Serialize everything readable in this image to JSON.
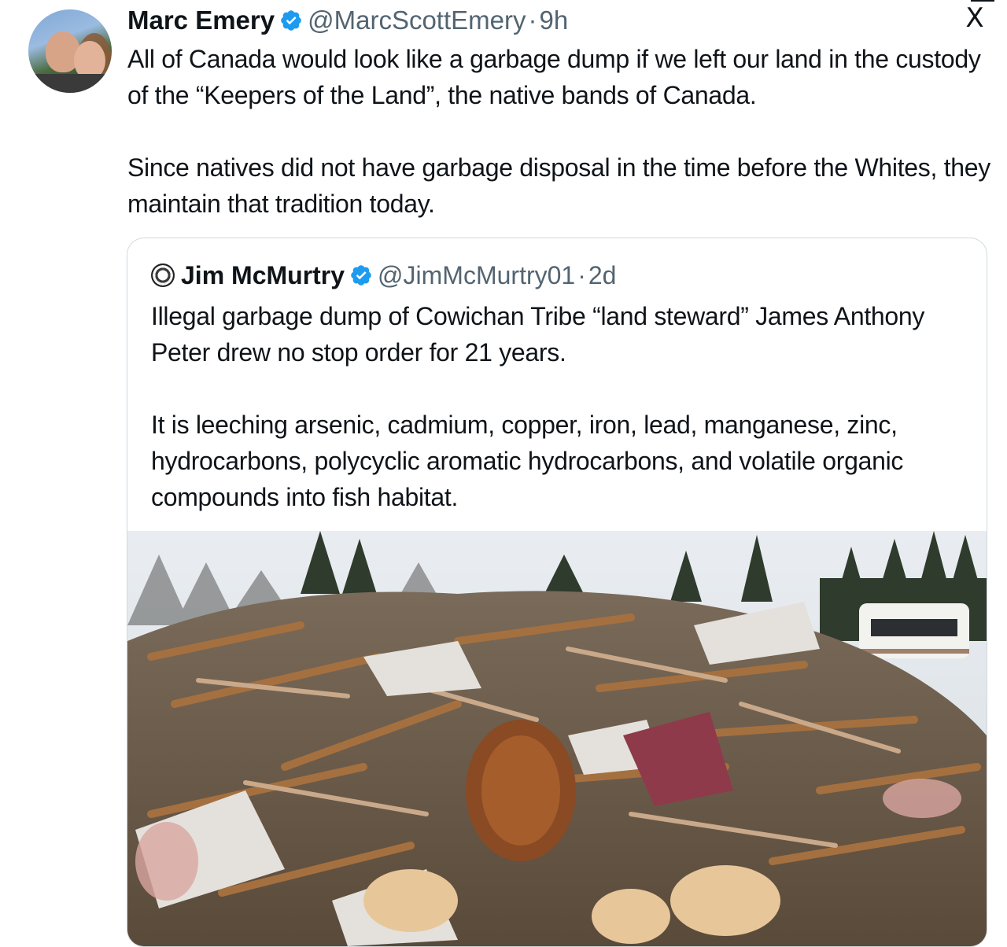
{
  "tweet": {
    "author": {
      "name": "Marc Emery",
      "handle": "@MarcScottEmery",
      "separator": "·",
      "time": "9h"
    },
    "paragraphs": [
      "All of Canada would look like a garbage dump if we left our land in the custody of the “Keepers of the Land”, the native bands of Canada.",
      "Since natives did not have garbage disposal in the time before the Whites, they maintain that tradition today."
    ],
    "close_icon": "X"
  },
  "quoted": {
    "author": {
      "name": "Jim McMurtry",
      "handle": "@JimMcMurtry01",
      "separator": "·",
      "time": "2d"
    },
    "paragraphs": [
      "Illegal garbage dump of Cowichan Tribe “land steward” James Anthony Peter drew no stop order for 21 years.",
      "It is leeching arsenic, cadmium, copper, iron, lead, manganese, zinc, hydrocarbons, polycyclic aromatic hydrocarbons, and volatile organic compounds into fish habitat."
    ]
  },
  "icons": {
    "verified": "verified-badge-icon",
    "close": "x-logo-icon"
  },
  "colors": {
    "text": "#0f1419",
    "secondary": "#536471",
    "verified": "#1d9bf0",
    "border": "#cfd9de"
  }
}
